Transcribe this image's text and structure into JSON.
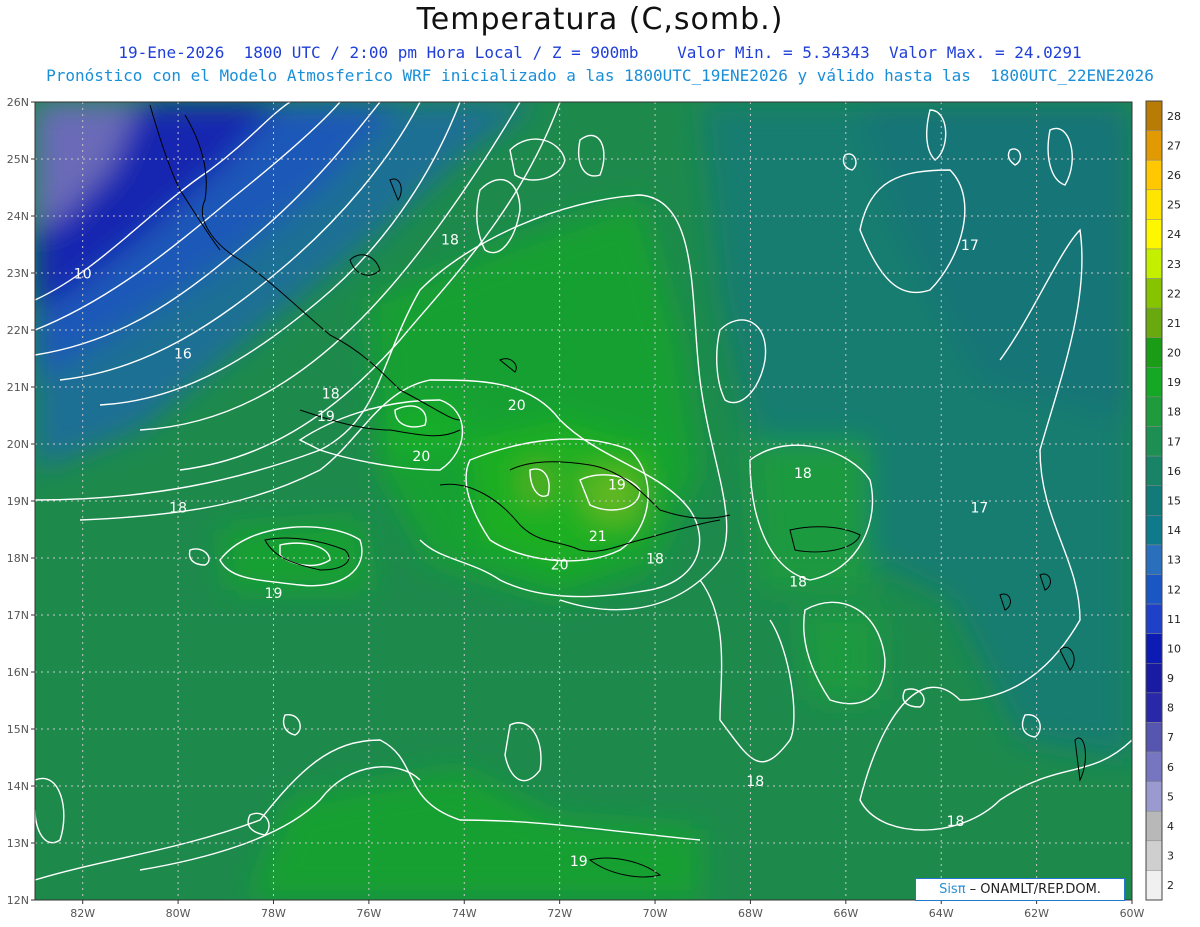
{
  "header": {
    "title": "Temperatura (C,somb.)",
    "line1": "19-Ene-2026  1800 UTC / 2:00 pm Hora Local / Z = 900mb    Valor Min. = 5.34343  Valor Max. = 24.0291",
    "line2": "Pronóstico con el Modelo Atmosferico WRF inicializado a las 1800UTC_19ENE2026 y válido hasta las  1800UTC_22ENE2026"
  },
  "map": {
    "lon_range": [
      -83,
      -60
    ],
    "lat_range": [
      12,
      26
    ],
    "lat_labels": [
      "26N",
      "25N",
      "24N",
      "23N",
      "22N",
      "21N",
      "20N",
      "19N",
      "18N",
      "17N",
      "16N",
      "15N",
      "14N",
      "13N",
      "12N"
    ],
    "lon_labels": [
      "82W",
      "80W",
      "78W",
      "76W",
      "74W",
      "72W",
      "70W",
      "68W",
      "66W",
      "64W",
      "62W",
      "60W"
    ],
    "contour_labels": [
      {
        "text": "18",
        "lon": -74.3,
        "lat": 23.5
      },
      {
        "text": "17",
        "lon": -63.4,
        "lat": 23.4
      },
      {
        "text": "10",
        "lon": -82.0,
        "lat": 22.9
      },
      {
        "text": "16",
        "lon": -79.9,
        "lat": 21.5
      },
      {
        "text": "18",
        "lon": -76.8,
        "lat": 20.8
      },
      {
        "text": "19",
        "lon": -76.9,
        "lat": 20.4
      },
      {
        "text": "20",
        "lon": -72.9,
        "lat": 20.6
      },
      {
        "text": "20",
        "lon": -74.9,
        "lat": 19.7
      },
      {
        "text": "19",
        "lon": -70.8,
        "lat": 19.2
      },
      {
        "text": "18",
        "lon": -66.9,
        "lat": 19.4
      },
      {
        "text": "17",
        "lon": -63.2,
        "lat": 18.8
      },
      {
        "text": "18",
        "lon": -80.0,
        "lat": 18.8
      },
      {
        "text": "21",
        "lon": -71.2,
        "lat": 18.3
      },
      {
        "text": "20",
        "lon": -72.0,
        "lat": 17.8
      },
      {
        "text": "18",
        "lon": -70.0,
        "lat": 17.9
      },
      {
        "text": "18",
        "lon": -67.0,
        "lat": 17.5
      },
      {
        "text": "19",
        "lon": -78.0,
        "lat": 17.3
      },
      {
        "text": "18",
        "lon": -67.9,
        "lat": 14.0
      },
      {
        "text": "18",
        "lon": -63.7,
        "lat": 13.3
      },
      {
        "text": "19",
        "lon": -71.6,
        "lat": 12.6
      }
    ]
  },
  "colorbar": {
    "levels": [
      28,
      27,
      26,
      25,
      24,
      23,
      22,
      21,
      20,
      19,
      18,
      17,
      16,
      15,
      14,
      13,
      12,
      11,
      10,
      9,
      8,
      7,
      6,
      5,
      4,
      3,
      2
    ],
    "colors": [
      "#b87c06",
      "#e29a04",
      "#ffc800",
      "#ffe500",
      "#fff700",
      "#c4f000",
      "#86c400",
      "#6aa810",
      "#1a9c16",
      "#14a824",
      "#1f9a3c",
      "#1d8f52",
      "#188366",
      "#127a78",
      "#0e7a8a",
      "#2a6fbb",
      "#1a57c4",
      "#1f40c8",
      "#0b1bb3",
      "#1a1ba3",
      "#2828a8",
      "#5656b0",
      "#7676c0",
      "#9a9ad0",
      "#b8b8b8",
      "#cfcfcf",
      "#f0f0f0"
    ]
  },
  "credit": {
    "brand": "Sisπ",
    "text": "– ONAMLT/REP.DOM."
  }
}
